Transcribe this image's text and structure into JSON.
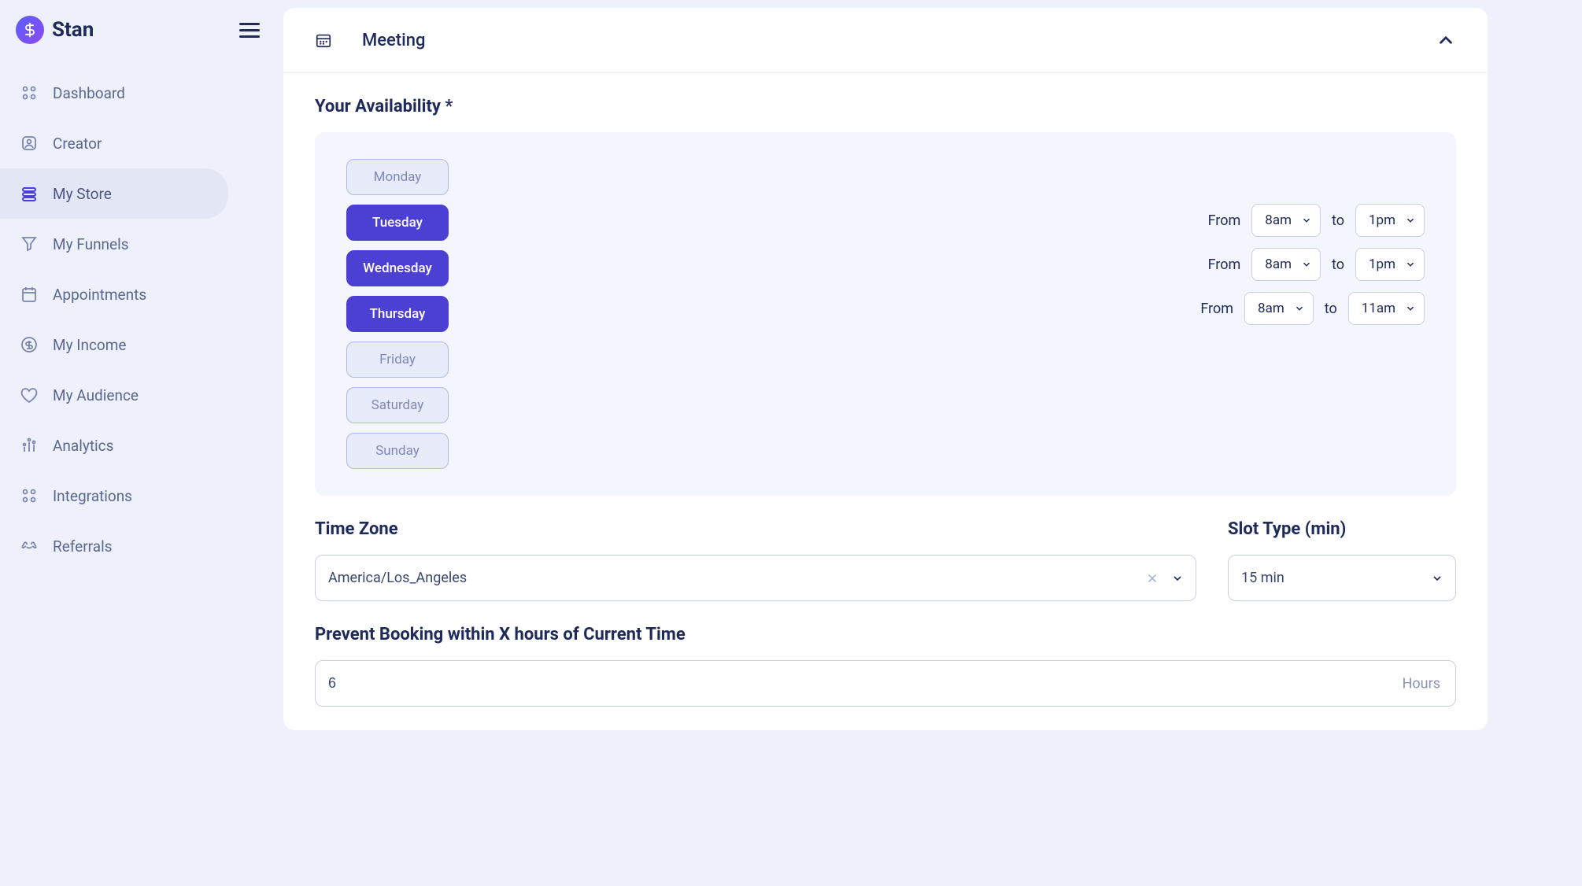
{
  "app": {
    "name": "Stan"
  },
  "sidebar": {
    "items": [
      {
        "label": "Dashboard",
        "key": "dashboard"
      },
      {
        "label": "Creator",
        "key": "creator"
      },
      {
        "label": "My Store",
        "key": "my-store"
      },
      {
        "label": "My Funnels",
        "key": "my-funnels"
      },
      {
        "label": "Appointments",
        "key": "appointments"
      },
      {
        "label": "My Income",
        "key": "my-income"
      },
      {
        "label": "My Audience",
        "key": "my-audience"
      },
      {
        "label": "Analytics",
        "key": "analytics"
      },
      {
        "label": "Integrations",
        "key": "integrations"
      },
      {
        "label": "Referrals",
        "key": "referrals"
      }
    ],
    "active": "my-store"
  },
  "meeting": {
    "title": "Meeting",
    "availability": {
      "label": "Your Availability *",
      "days": [
        {
          "name": "Monday",
          "selected": false
        },
        {
          "name": "Tuesday",
          "selected": true,
          "from": "8am",
          "to": "1pm"
        },
        {
          "name": "Wednesday",
          "selected": true,
          "from": "8am",
          "to": "1pm"
        },
        {
          "name": "Thursday",
          "selected": true,
          "from": "8am",
          "to": "11am"
        },
        {
          "name": "Friday",
          "selected": false
        },
        {
          "name": "Saturday",
          "selected": false
        },
        {
          "name": "Sunday",
          "selected": false
        }
      ],
      "from_label": "From",
      "to_label": "to"
    },
    "timezone": {
      "label": "Time Zone",
      "value": "America/Los_Angeles"
    },
    "slot_type": {
      "label": "Slot Type (min)",
      "value": "15 min"
    },
    "prevent_booking": {
      "label": "Prevent Booking within X hours of Current Time",
      "value": "6",
      "suffix": "Hours"
    }
  }
}
